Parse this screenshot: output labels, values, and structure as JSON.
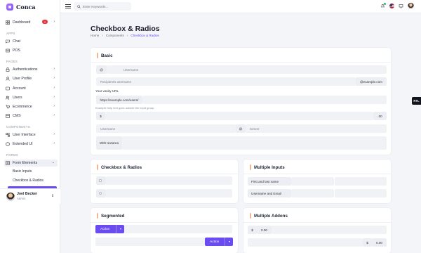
{
  "app": {
    "name": "Conca"
  },
  "sidebar": {
    "dashboard": {
      "label": "Dashboard",
      "badge": "2"
    },
    "sections": {
      "apps": "APPS",
      "pages": "PAGES",
      "components": "COMPONENTS",
      "forms": "FORMS"
    },
    "apps": [
      {
        "label": "Chat"
      },
      {
        "label": "POS"
      }
    ],
    "pages": [
      {
        "label": "Authentications"
      },
      {
        "label": "User Profile"
      },
      {
        "label": "Account"
      },
      {
        "label": "Users"
      },
      {
        "label": "Ecommerce"
      },
      {
        "label": "CMS"
      }
    ],
    "components": [
      {
        "label": "User Interface"
      },
      {
        "label": "Extended UI"
      }
    ],
    "forms": {
      "label": "Form Elements",
      "sub": [
        {
          "label": "Basic Inputs"
        },
        {
          "label": "Checkbox & Radios"
        }
      ]
    },
    "user": {
      "name": "Joel Becker",
      "role": "Admin"
    }
  },
  "topbar": {
    "search_placeholder": "Enter Keywords..."
  },
  "page": {
    "title": "Checkbox & Radios",
    "breadcrumb": [
      "Home",
      "Components",
      "Checkbox & Radios"
    ]
  },
  "basic": {
    "title": "Basic",
    "at_symbol": "@",
    "username_placeholder": "Username",
    "recipient_placeholder": "Recipient's username",
    "example_addon": "@example.com",
    "vanity_label": "Your vanity URL",
    "vanity_addon": "https://example.com/users/",
    "help_text": "Example help text goes outside the input group.",
    "dollar": "$",
    "cents": ".00",
    "username2_placeholder": "Username",
    "at2": "@",
    "server_placeholder": "Server",
    "textarea_label": "With textarea"
  },
  "checkbox_radios": {
    "title": "Checkbox & Radios"
  },
  "multiple_inputs": {
    "title": "Multiple Inputs",
    "rows": [
      {
        "label": "First and last name"
      },
      {
        "label": "Username and Email"
      }
    ]
  },
  "segmented": {
    "title": "Segmented",
    "button_label": "Action",
    "button2_label": "Action"
  },
  "multiple_addons": {
    "title": "Multiple Addons",
    "row1": {
      "symbol": "$",
      "value": "0.00"
    },
    "row2": {
      "symbol": "$",
      "value": "0.00"
    }
  },
  "rtl_label": "RTL"
}
